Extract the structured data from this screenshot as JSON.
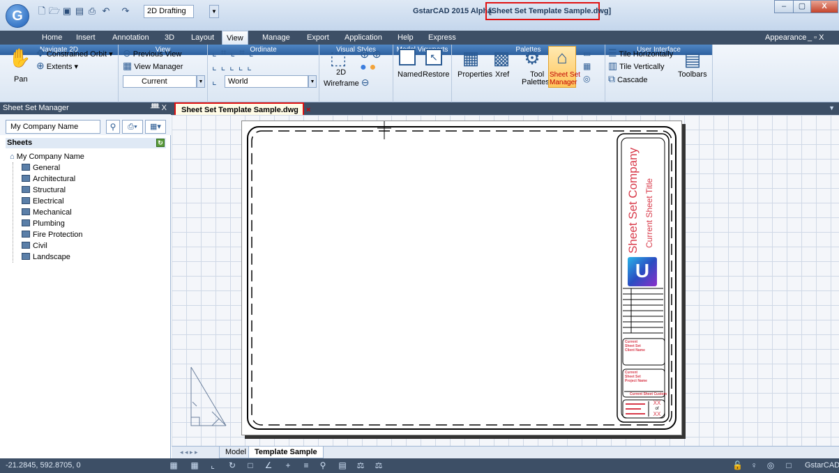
{
  "app": {
    "logo": "G",
    "workspace": "2D Drafting",
    "title": "GstarCAD 2015 Alpha",
    "title_file": "[Sheet Set Template Sample.dwg]",
    "window_controls": [
      "–",
      "▢",
      "X"
    ]
  },
  "quick_access": [
    "new-icon",
    "open-icon",
    "save-icon",
    "saveas-icon",
    "print-icon",
    "undo-icon",
    "redo-icon"
  ],
  "menu": {
    "items": [
      "Home",
      "Insert",
      "Annotation",
      "3D",
      "Layout",
      "View",
      "Manage",
      "Export",
      "Application",
      "Help",
      "Express"
    ],
    "active": "View",
    "right_label": "Appearance",
    "right_controls": "_ ▫ X"
  },
  "ribbon": {
    "navigate2d": {
      "pan": "Pan",
      "constrained_orbit": "Constrained Orbit",
      "extents": "Extents",
      "footer": "Navigate 2D"
    },
    "view": {
      "previous_view": "Previous View",
      "view_manager": "View Manager",
      "current": "Current",
      "footer": "View"
    },
    "ordinate": {
      "world": "World",
      "footer": "Ordinate"
    },
    "visual_styles": {
      "wireframe_top": "2D",
      "wireframe": "Wireframe",
      "footer": "Visual Styles"
    },
    "model_viewports": {
      "named": "Named",
      "restore": "Restore",
      "footer": "Model Viewports"
    },
    "palettes": {
      "properties": "Properties",
      "xref": "Xref",
      "tool": "Tool",
      "tool2": "Palettes",
      "ssm": "Sheet Set",
      "ssm2": "Manager",
      "footer": "Palettes"
    },
    "ui": {
      "tile_h": "Tile Horizontally",
      "tile_v": "Tile Vertically",
      "cascade": "Cascade",
      "toolbars": "Toolbars",
      "footer": "User Interface"
    }
  },
  "sheet_set_manager": {
    "title": "Sheet Set Manager",
    "controls": "ᚙ X",
    "combo": "My Company Name",
    "sheets_label": "Sheets",
    "root": "My Company Name",
    "items": [
      "General",
      "Architectural",
      "Structural",
      "Electrical",
      "Mechanical",
      "Plumbing",
      "Fire Protection",
      "Civil",
      "Landscape"
    ]
  },
  "document": {
    "tab": "Sheet Set Template Sample.dwg",
    "tab_close": "×",
    "title_block": {
      "company": "Sheet Set Company",
      "sheet_title": "Current Sheet Title",
      "box1": [
        "Current",
        "Sheet Set",
        "Client Name"
      ],
      "box2": [
        "Current",
        "Sheet Set",
        "Project Name"
      ],
      "box2_footer": "Current Sheet Custom",
      "num_top": "XX",
      "num_mid": "of",
      "num_bottom": "XX"
    }
  },
  "layout_tabs": {
    "nav": "◂ ◂ ▸ ▸",
    "items": [
      "Model",
      "Template Sample"
    ],
    "active": "Template Sample"
  },
  "status": {
    "coords": "-21.2845, 592.8705, 0",
    "brand": "GstarCAD"
  },
  "colors": {
    "accent_red": "#e01010",
    "title_block_text": "#d83a4a",
    "dark_bar": "#3d4f66",
    "ribbon_footer": "#2d5f9e"
  }
}
